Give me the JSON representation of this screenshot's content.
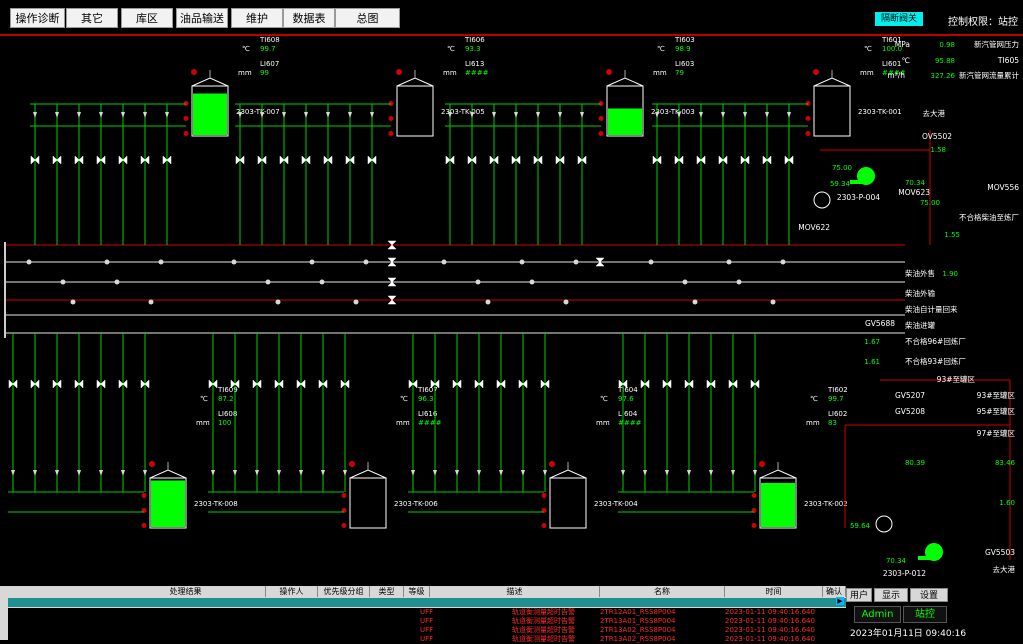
{
  "menu": [
    "总图",
    "数据表",
    "维护",
    "油品输送",
    "库区",
    "其它",
    "操作诊断"
  ],
  "status_box": "隔断阀关",
  "top_right": "控制权限：站控",
  "tanks": [
    {
      "id": "2303-TK-007",
      "tag": "TI608",
      "temp": "99.7",
      "unit": "℃",
      "level_tag": "LI607",
      "level": "99",
      "level_unit": "mm"
    },
    {
      "id": "2303-TK-005",
      "tag": "TI606",
      "temp": "93.3",
      "unit": "℃",
      "level_tag": "LI613",
      "level": "####",
      "level_unit": "mm"
    },
    {
      "id": "2303-TK-003",
      "tag": "TI603",
      "temp": "98.9",
      "unit": "℃",
      "level_tag": "LI603",
      "level": "79",
      "level_unit": "mm"
    },
    {
      "id": "2303-TK-001",
      "tag": "TI601",
      "temp": "100.0",
      "unit": "℃",
      "level_tag": "LI601",
      "level": "####",
      "level_unit": "mm"
    },
    {
      "id": "2303-TK-008",
      "tag": "TI609",
      "temp": "87.2",
      "unit": "℃",
      "level_tag": "LI608",
      "level": "100",
      "level_unit": "mm"
    },
    {
      "id": "2303-TK-006",
      "tag": "TI607",
      "temp": "96.3",
      "unit": "℃",
      "level_tag": "LI616",
      "level": "####",
      "level_unit": "mm"
    },
    {
      "id": "2303-TK-004",
      "tag": "TI604",
      "temp": "97.6",
      "unit": "℃",
      "level_tag": "LI604",
      "level": "####",
      "level_unit": "mm"
    },
    {
      "id": "2303-TK-002",
      "tag": "TI602",
      "temp": "99.7",
      "unit": "℃",
      "level_tag": "LI602",
      "level": "83",
      "level_unit": "mm"
    }
  ],
  "right_labels": {
    "steam_pressure": "新汽管网压力",
    "steam_pressure_val": "0.98",
    "steam_pressure_unit": "MPa",
    "ti605": "TI605",
    "ti605_val": "95.88",
    "ti605_unit": "℃",
    "steam_flow": "新汽管网流量累计",
    "steam_flow_val": "327.26",
    "steam_flow_unit": "m³/h",
    "big_outlet": "去大港",
    "gv_ov5502": "OV5502",
    "val_1_58": "1.58",
    "pump_p004": "2303-P-004",
    "mov556": "MOV556",
    "mov623": "MOV623",
    "mov622": "MOV622",
    "val_75": "75.00",
    "val_59_34": "59.34",
    "val_70_34": "70.34",
    "val_75b": "75.00",
    "unqualified_oil": "不合格柴油至炼厂",
    "val_1_55": "1.55",
    "line_sale": "柴油外售",
    "line_sale_val": "1.90",
    "line_export": "柴油外输",
    "line_self": "柴油自计量回来",
    "line_tank": "柴油进罐",
    "gv5688": "GV5688",
    "unq_96": "不合格96#回炼厂",
    "unq_96_val": "1.67",
    "unq_93": "不合格93#回炼厂",
    "unq_93_val": "1.61",
    "g93_area": "93#至罐区",
    "g93b": "93#至罐区",
    "g95": "95#至罐区",
    "g97": "97#至罐区",
    "gv5207": "GV5207",
    "gv5208": "GV5208",
    "val_83_46": "83.46",
    "val_80_39": "80.39",
    "val_1_60": "1.60",
    "val_59_64": "59.64",
    "val_70_34b": "70.34",
    "pump_p012": "2303-P-012",
    "gv5503": "GV5503",
    "big_outlet2": "去大港"
  },
  "alarm": {
    "headers": [
      "确认",
      "时间",
      "名称",
      "描述",
      "等级",
      "类型",
      "优先级分组",
      "操作人",
      "处理结果"
    ],
    "rows": [
      {
        "ack": "",
        "time": "2023-01-11 09:40:16.640",
        "name": "2TR12A01_RSS8P004",
        "desc": "轨道衡测量超时告警",
        "level": "UFF",
        "type": "",
        "group": "",
        "op": "",
        "res": ""
      },
      {
        "ack": "",
        "time": "2023-01-11 09:40:16.640",
        "name": "2TR13A01_RSS8P004",
        "desc": "轨道衡测量超时告警",
        "level": "UFF",
        "type": "",
        "group": "",
        "op": "",
        "res": ""
      },
      {
        "ack": "",
        "time": "2023-01-11 09:40:16.640",
        "name": "2TR13A02_RSS8P004",
        "desc": "轨道衡测量超时告警",
        "level": "UFF",
        "type": "",
        "group": "",
        "op": "",
        "res": ""
      },
      {
        "ack": "",
        "time": "2023-01-11 09:40:16.640",
        "name": "2TR13A02_RSS8P004",
        "desc": "轨道衡测量超时告警",
        "level": "UFF",
        "type": "",
        "group": "",
        "op": "",
        "res": ""
      }
    ]
  },
  "bottom_right": {
    "btn_settings": "设置",
    "btn_display": "显示",
    "btn_user": "用户",
    "user": "Admin",
    "login": "站控",
    "datetime": "2023年01月11日 09:40:16"
  }
}
